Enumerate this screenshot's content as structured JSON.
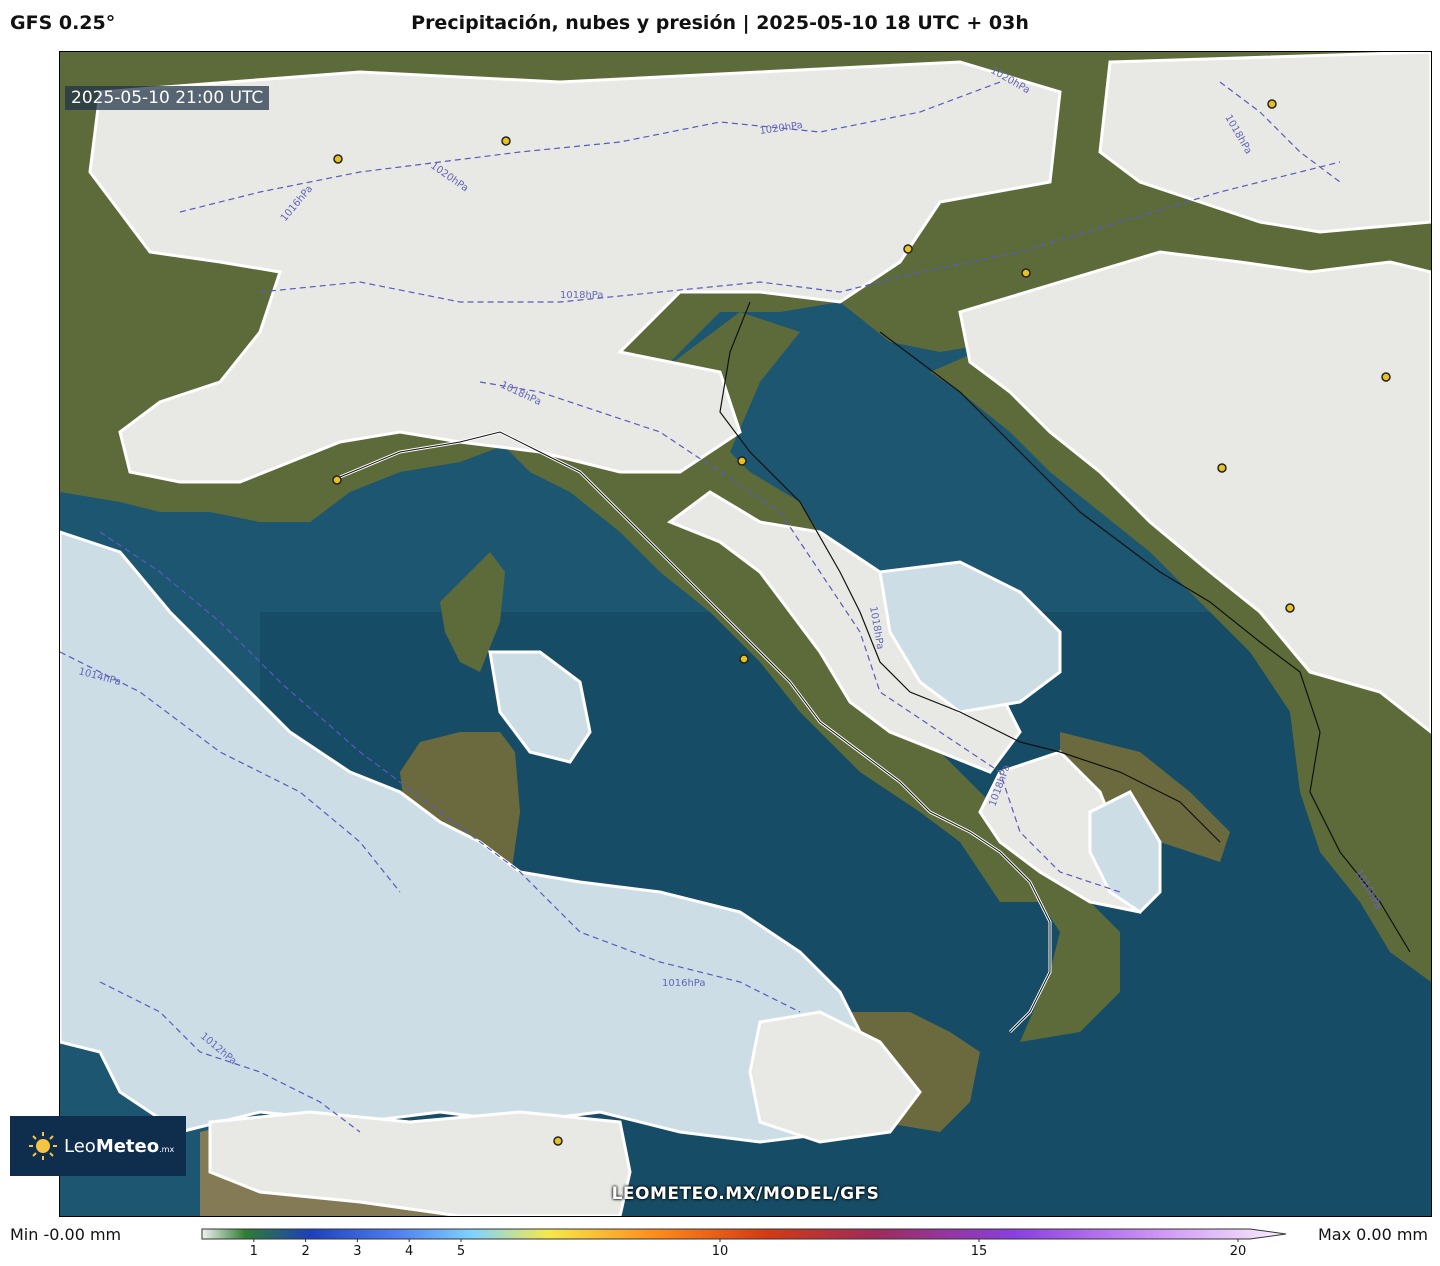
{
  "header": {
    "model": "GFS 0.25°",
    "title": "Precipitación, nubes y presión | 2025-05-10 18 UTC + 03h"
  },
  "map": {
    "valid_time": "2025-05-10 21:00 UTC",
    "watermark_url": "LEOMETEO.MX/MODEL/GFS",
    "isobar_labels": [
      "1020hPa",
      "1020hPa",
      "1018hPa",
      "1016hPa",
      "1020hPa",
      "1018hPa",
      "1018hPa",
      "1014hPa",
      "1018hPa",
      "1018hPa",
      "1016hPa",
      "1012hPa",
      "1016hPa"
    ],
    "colors": {
      "sea": "#1d5670",
      "deep_sea": "#12415a",
      "land": "#5d6b3a",
      "cloud": "#e8e9e4",
      "low_cloud_over_sea": "#ccdde6",
      "isobar": "#5a5abf",
      "coastline": "#111111",
      "city_marker": "#e8c020"
    }
  },
  "logo": {
    "name_light": "Leo",
    "name_bold": "Meteo",
    "suffix": ".mx"
  },
  "legend": {
    "min_label": "Min -0.00 mm",
    "max_label": "Max 0.00 mm",
    "ticks": [
      "1",
      "2",
      "3",
      "4",
      "5",
      "10",
      "15",
      "20"
    ],
    "tick_values": [
      1,
      2,
      3,
      4,
      5,
      10,
      15,
      20
    ],
    "range": [
      0,
      20
    ],
    "gradient_colors": [
      "#f2f2f2",
      "#2e7d32",
      "#1e3fbf",
      "#4f7ff0",
      "#7fd3ff",
      "#f5e94a",
      "#ff8a1a",
      "#d43a12",
      "#a02a5a",
      "#8a3fe0",
      "#c98cf5",
      "#fbeefc"
    ]
  }
}
